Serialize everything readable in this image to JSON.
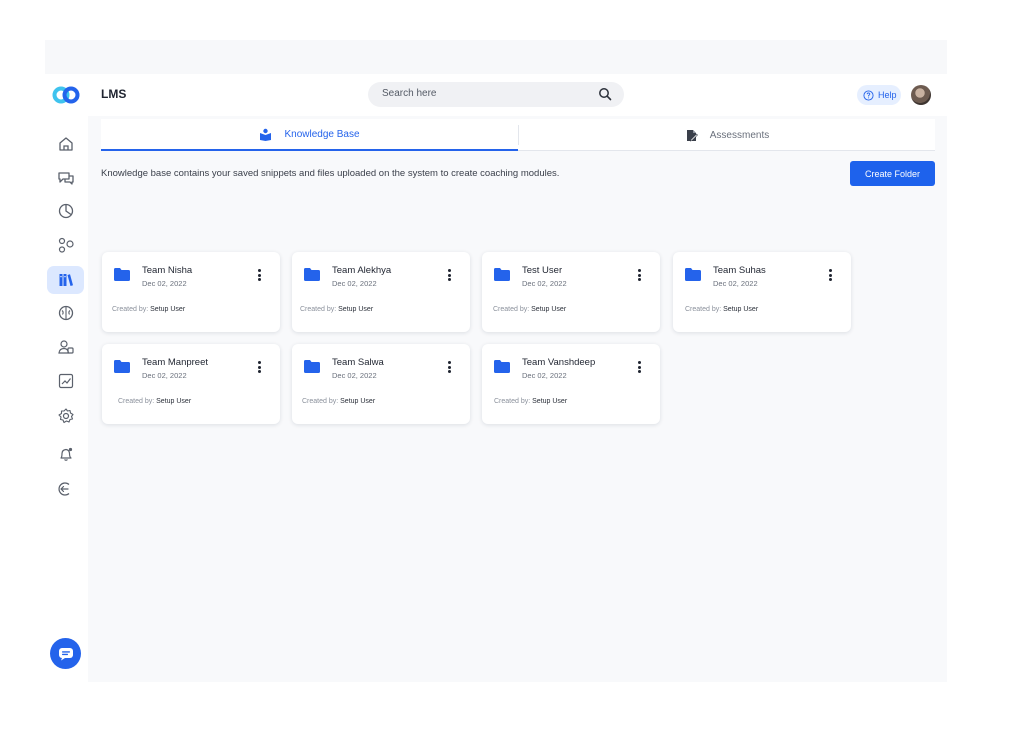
{
  "header": {
    "app_title": "LMS",
    "search_placeholder": "Search here",
    "help_label": "Help"
  },
  "sidebar": {
    "items": [
      {
        "name": "home",
        "icon": "home-icon",
        "active": false
      },
      {
        "name": "chat",
        "icon": "chat-bubbles-icon",
        "active": false
      },
      {
        "name": "analytics",
        "icon": "pie-chart-icon",
        "active": false
      },
      {
        "name": "network",
        "icon": "nodes-icon",
        "active": false
      },
      {
        "name": "library",
        "icon": "books-icon",
        "active": true
      },
      {
        "name": "brain",
        "icon": "brain-icon",
        "active": false
      },
      {
        "name": "users",
        "icon": "users-icon",
        "active": false
      },
      {
        "name": "reports",
        "icon": "line-chart-icon",
        "active": false
      },
      {
        "name": "settings",
        "icon": "gear-icon",
        "active": false
      },
      {
        "name": "notifications",
        "icon": "bell-icon",
        "active": false
      },
      {
        "name": "logout",
        "icon": "logout-icon",
        "active": false
      }
    ]
  },
  "tabs": {
    "knowledge_base": "Knowledge Base",
    "assessments": "Assessments"
  },
  "description": "Knowledge base contains your saved snippets and files uploaded on the system to create coaching modules.",
  "create_folder_label": "Create Folder",
  "created_by_prefix": "Created by:",
  "folders": [
    {
      "title": "Team Nisha",
      "date": "Dec 02, 2022",
      "created_by": "Setup User"
    },
    {
      "title": "Team Alekhya",
      "date": "Dec 02, 2022",
      "created_by": "Setup User"
    },
    {
      "title": "Test User",
      "date": "Dec 02, 2022",
      "created_by": "Setup User"
    },
    {
      "title": "Team Suhas",
      "date": "Dec 02, 2022",
      "created_by": "Setup User"
    },
    {
      "title": "Team Manpreet",
      "date": "Dec 02, 2022",
      "created_by": "Setup User"
    },
    {
      "title": "Team Salwa",
      "date": "Dec 02, 2022",
      "created_by": "Setup User"
    },
    {
      "title": "Team Vanshdeep",
      "date": "Dec 02, 2022",
      "created_by": "Setup User"
    }
  ],
  "colors": {
    "accent": "#2463eb",
    "active_nav_bg": "#dce8ff",
    "logo_cyan": "#3fc3ee",
    "logo_blue": "#2463eb"
  }
}
